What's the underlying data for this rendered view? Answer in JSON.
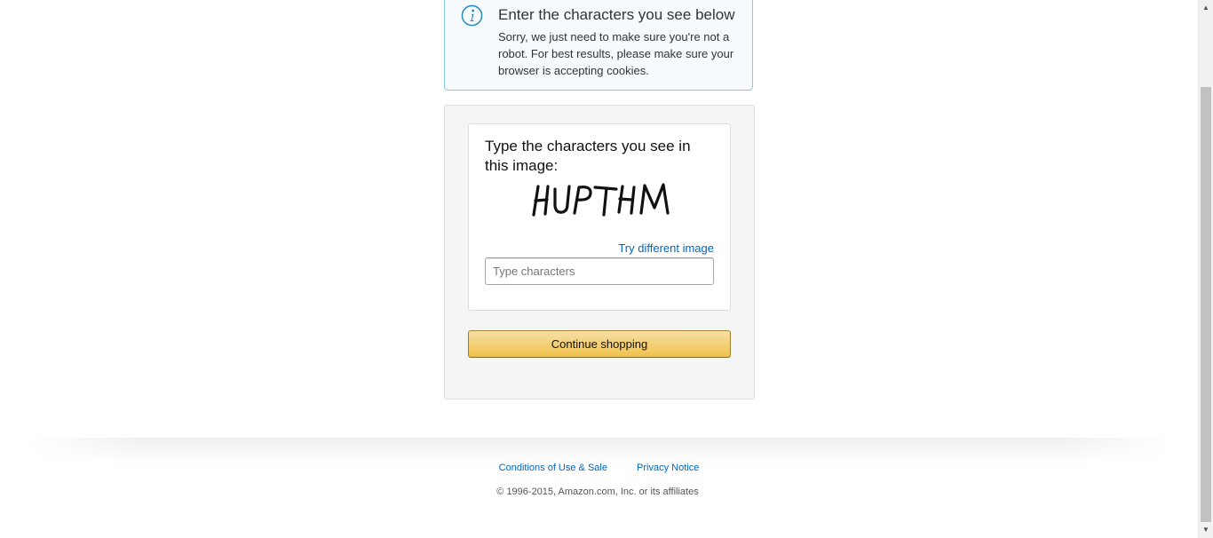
{
  "alert": {
    "heading": "Enter the characters you see below",
    "text": "Sorry, we just need to make sure you're not a robot. For best results, please make sure your browser is accepting cookies.",
    "icon": "info-icon",
    "border_color": "#8ac9e3"
  },
  "captcha": {
    "prompt": "Type the characters you see in this image:",
    "image_text": "HUPTHM",
    "try_different_label": "Try different image",
    "input_placeholder": "Type characters",
    "input_value": ""
  },
  "actions": {
    "continue_label": "Continue shopping",
    "button_color": "#f0c14b"
  },
  "footer": {
    "conditions_label": "Conditions of Use & Sale",
    "privacy_label": "Privacy Notice",
    "copyright": "© 1996-2015, Amazon.com, Inc. or its affiliates",
    "link_color": "#0066c0"
  }
}
